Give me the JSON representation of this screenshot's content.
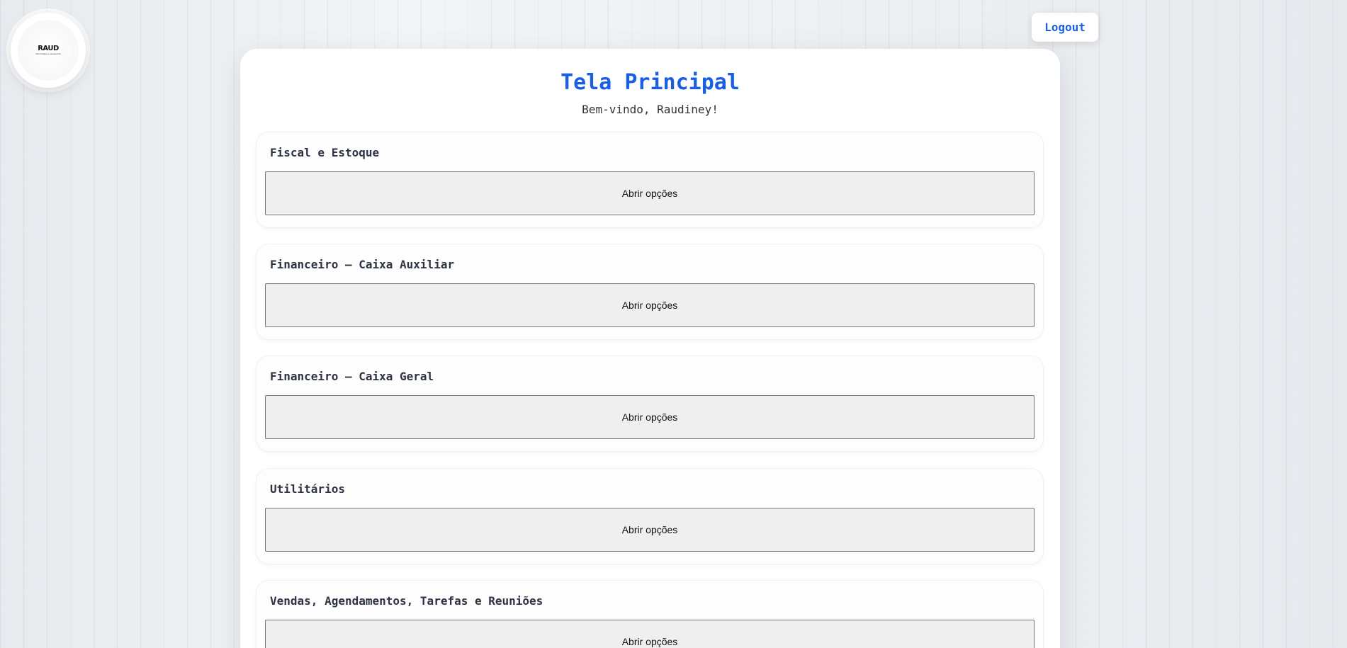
{
  "logo": {
    "text": "RAUD",
    "sub": "tecnologia e assessoria"
  },
  "header": {
    "logout_label": "Logout"
  },
  "main": {
    "title": "Tela Principal",
    "subtitle": "Bem-vindo, Raudiney!",
    "sections": [
      {
        "title": "Fiscal e Estoque",
        "button": "Abrir opções"
      },
      {
        "title": "Financeiro — Caixa Auxiliar",
        "button": "Abrir opções"
      },
      {
        "title": "Financeiro — Caixa Geral",
        "button": "Abrir opções"
      },
      {
        "title": "Utilitários",
        "button": "Abrir opções"
      },
      {
        "title": "Vendas, Agendamentos, Tarefas e Reuniões",
        "button": "Abrir opções"
      }
    ]
  },
  "colors": {
    "accent": "#1a5fe0",
    "background": "#eef0f3",
    "card": "#ffffff"
  }
}
